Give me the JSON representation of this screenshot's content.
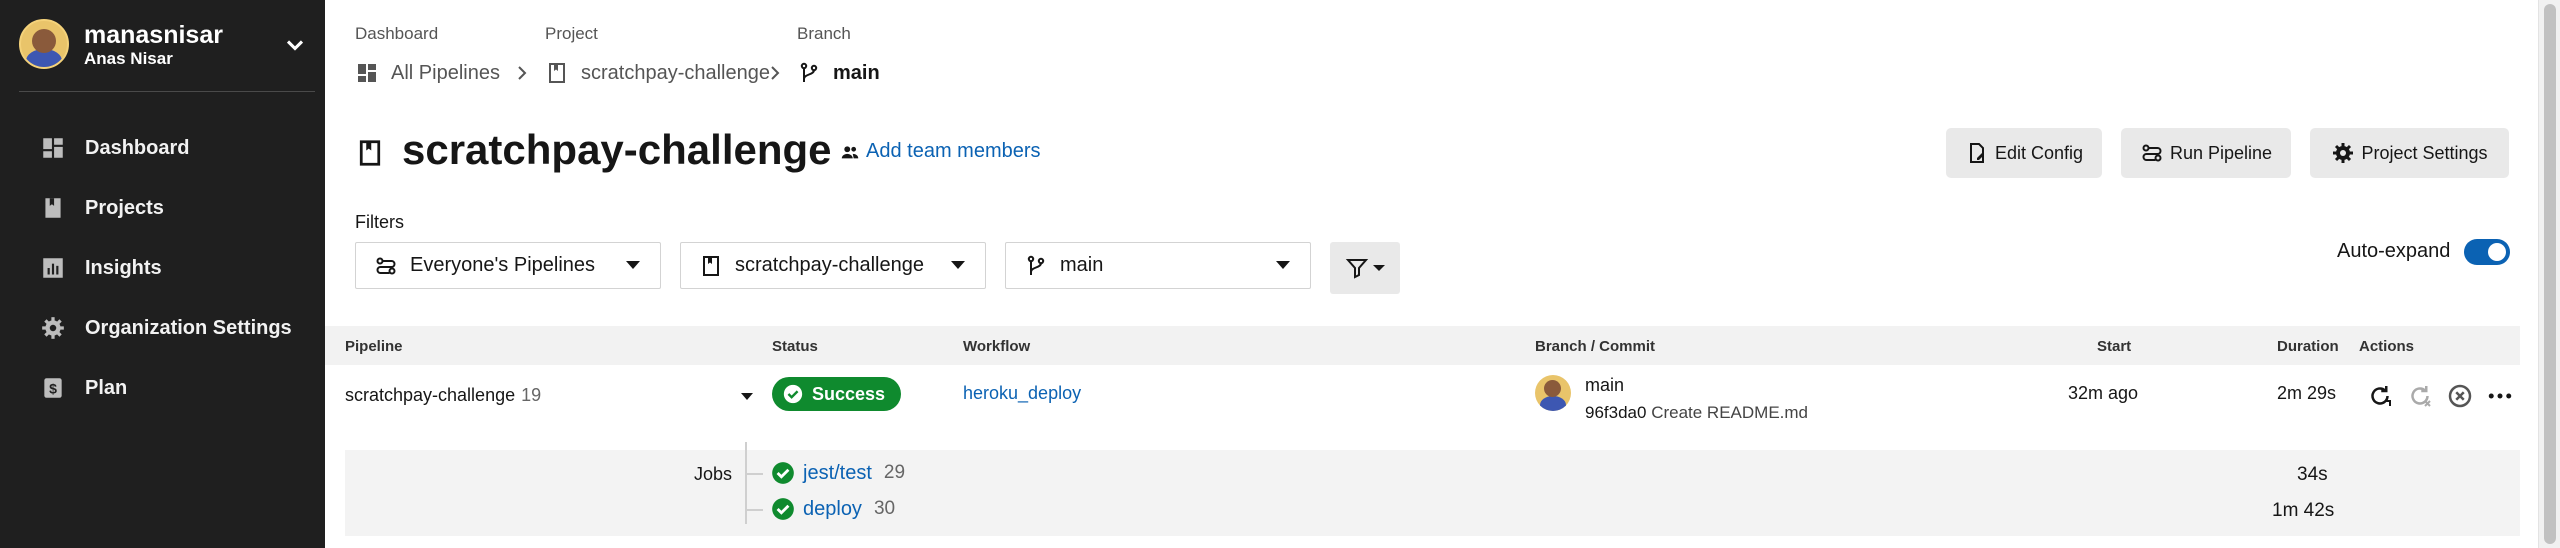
{
  "user": {
    "username": "manasnisar",
    "full_name": "Anas Nisar"
  },
  "nav": {
    "items": [
      {
        "label": "Dashboard",
        "icon": "dashboard-icon"
      },
      {
        "label": "Projects",
        "icon": "projects-icon"
      },
      {
        "label": "Insights",
        "icon": "insights-icon"
      },
      {
        "label": "Organization Settings",
        "icon": "gear-icon"
      },
      {
        "label": "Plan",
        "icon": "plan-icon"
      }
    ]
  },
  "breadcrumb": {
    "labels": [
      "Dashboard",
      "Project",
      "Branch"
    ],
    "items": [
      "All Pipelines",
      "scratchpay-challenge",
      "main"
    ]
  },
  "header": {
    "title": "scratchpay-challenge",
    "add_members": "Add team members",
    "edit_config": "Edit Config",
    "run_pipeline": "Run Pipeline",
    "project_settings": "Project Settings"
  },
  "filters": {
    "label": "Filters",
    "pipelines": "Everyone's Pipelines",
    "project": "scratchpay-challenge",
    "branch": "main",
    "auto_expand_label": "Auto-expand",
    "auto_expand_on": true
  },
  "table": {
    "headers": [
      "Pipeline",
      "Status",
      "Workflow",
      "Branch / Commit",
      "Start",
      "Duration",
      "Actions"
    ],
    "rows": [
      {
        "pipeline": "scratchpay-challenge",
        "number": "19",
        "status": "Success",
        "workflow": "heroku_deploy",
        "branch": "main",
        "commit_hash": "96f3da0",
        "commit_message": "Create README.md",
        "start": "32m ago",
        "duration": "2m 29s",
        "jobs_label": "Jobs",
        "jobs": [
          {
            "name": "jest/test",
            "number": "29",
            "duration": "34s"
          },
          {
            "name": "deploy",
            "number": "30",
            "duration": "1m 42s"
          }
        ]
      }
    ]
  },
  "colors": {
    "sidebar": "#1f1f1f",
    "accent": "#0b62b3",
    "success": "#0f8a2e",
    "button": "#e9e9e9"
  }
}
